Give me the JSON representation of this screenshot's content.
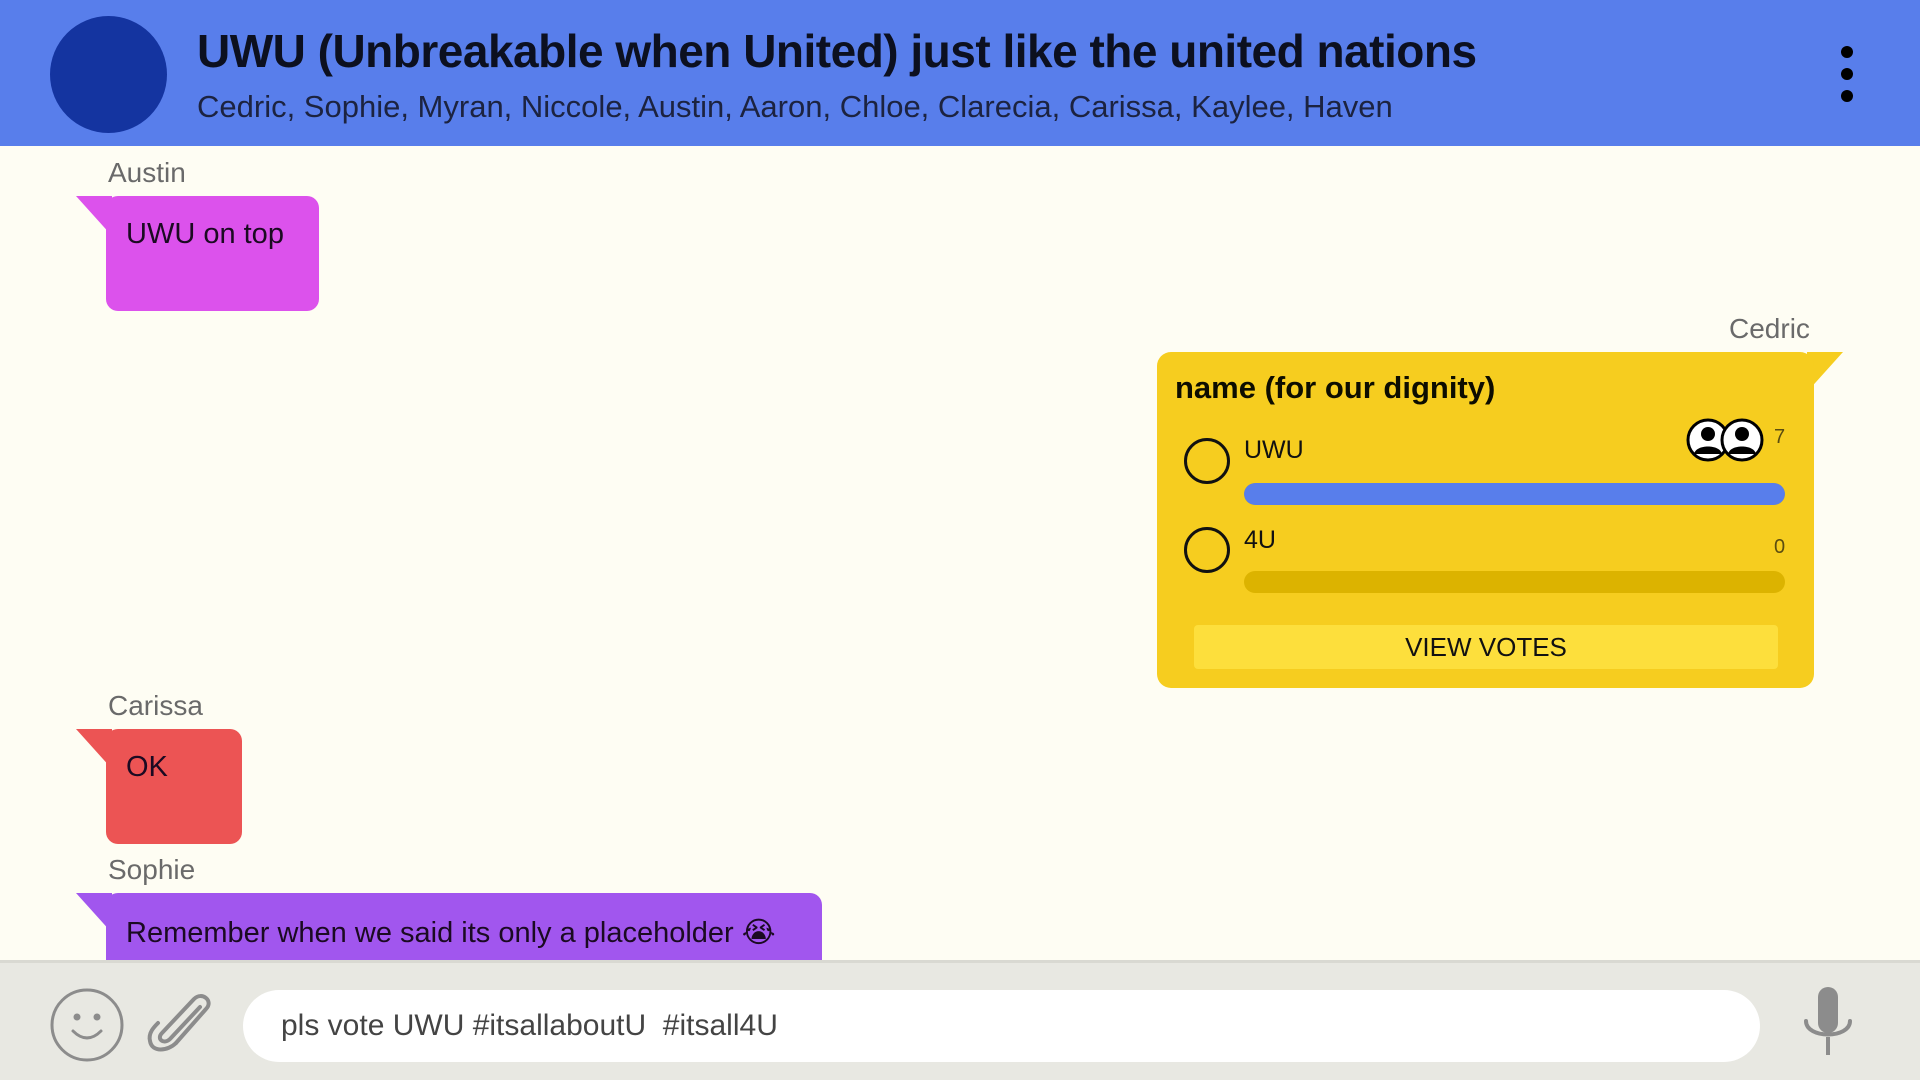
{
  "header": {
    "title": "UWU (Unbreakable when United) just like the united nations",
    "members": "Cedric, Sophie, Myran, Niccole, Austin, Aaron, Chloe, Clarecia, Carissa, Kaylee, Haven",
    "avatar_color": "#1434a0",
    "background_color": "#587eeb"
  },
  "messages": [
    {
      "sender": "Austin",
      "text": "UWU on top",
      "color": "#dc52ec"
    },
    {
      "sender": "Cedric",
      "poll": {
        "question": "name (for our dignity)",
        "options": [
          {
            "label": "UWU",
            "count": "7",
            "share": 1.0
          },
          {
            "label": "4U",
            "count": "0",
            "share": 0.0
          }
        ],
        "view_votes_label": "VIEW VOTES",
        "color": "#f6cd1f",
        "bar_color": "#587eeb"
      }
    },
    {
      "sender": "Carissa",
      "text": "OK",
      "color": "#ec5454"
    },
    {
      "sender": "Sophie",
      "text": "Remember when we said its only a placeholder 😭",
      "color": "#a156ee"
    }
  ],
  "composer": {
    "value": "pls vote UWU #itsallaboutU  #itsall4U",
    "icons": [
      "emoji-icon",
      "paperclip-icon",
      "microphone-icon"
    ]
  }
}
